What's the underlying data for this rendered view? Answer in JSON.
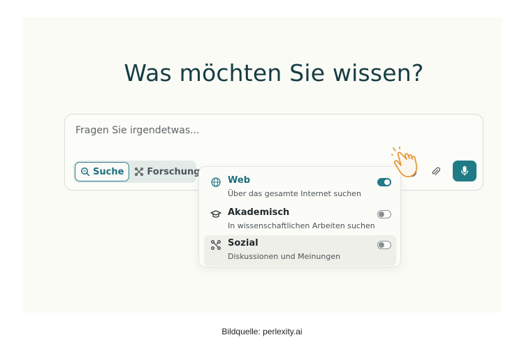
{
  "heading": "Was möchten Sie wissen?",
  "search": {
    "placeholder": "Fragen Sie irgendetwas..."
  },
  "modes": [
    {
      "label": "Suche",
      "icon": "search-icon",
      "active": true
    },
    {
      "label": "Forschung",
      "icon": "research-icon",
      "active": false
    }
  ],
  "toolbar": {
    "icons": [
      "chip-icon",
      "globe-icon",
      "paperclip-icon",
      "microphone-icon"
    ]
  },
  "sources": [
    {
      "title": "Web",
      "description": "Über das gesamte Internet suchen",
      "icon": "globe-icon",
      "enabled": true
    },
    {
      "title": "Akademisch",
      "description": "In wissenschaftlichen Arbeiten suchen",
      "icon": "graduation-cap-icon",
      "enabled": false
    },
    {
      "title": "Sozial",
      "description": "Diskussionen und Meinungen",
      "icon": "social-network-icon",
      "enabled": false
    }
  ],
  "caption": "Bildquelle: perlexity.ai",
  "colors": {
    "accent": "#217b86",
    "heading": "#163c44",
    "background": "#fbfbf5"
  }
}
